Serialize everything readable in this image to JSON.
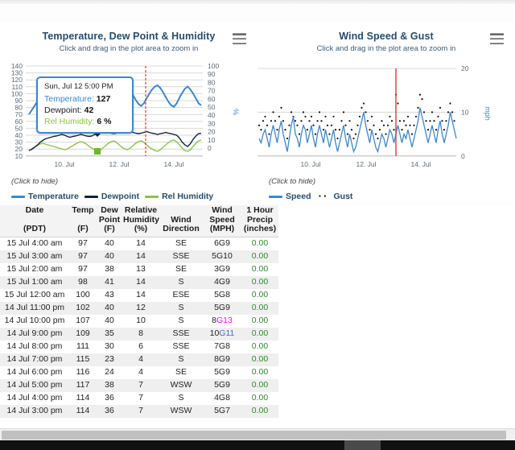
{
  "charts": [
    {
      "id": "temperature",
      "title": "Temperature, Dew Point & Humidity",
      "subtitle": "Click and drag in the plot area to zoom in",
      "menu_icon": "hamburger-menu-icon",
      "legend_hint": "(Click to hide)",
      "right_axis_unit": "%",
      "legend": [
        {
          "label": "Temperature",
          "color": "#3a87d4",
          "marker": "line"
        },
        {
          "label": "Dewpoint",
          "color": "#10233f",
          "marker": "line"
        },
        {
          "label": "Rel Humidity",
          "color": "#8bc53f",
          "marker": "line"
        }
      ],
      "tooltip": {
        "header": "Sun, Jul 12 5:00 PM",
        "rows": [
          {
            "label": "Temperature:",
            "value": "127",
            "color": "#3a87d4"
          },
          {
            "label": "Dewpoint:",
            "value": "42",
            "color": "#10233f"
          },
          {
            "label": "Rel Humidity:",
            "value": "6 %",
            "color": "#8bc53f"
          }
        ]
      }
    },
    {
      "id": "wind",
      "title": "Wind Speed & Gust",
      "subtitle": "Click and drag in the plot area to zoom in",
      "menu_icon": "hamburger-menu-icon",
      "legend_hint": "(Click to hide)",
      "right_axis_unit": "mph",
      "legend": [
        {
          "label": "Speed",
          "color": "#3a87d4",
          "marker": "line"
        },
        {
          "label": "Gust",
          "color": "#000000",
          "marker": "dots"
        }
      ]
    }
  ],
  "chart_data": [
    {
      "type": "line",
      "id": "temperature",
      "title": "Temperature, Dew Point & Humidity",
      "subtitle": "Click and drag in the plot area to zoom in",
      "xlabel": "",
      "ylabel": "",
      "right_ylabel": "%",
      "grid": true,
      "legend_position": "bottom-left",
      "x_ticks": [
        "10. Jul",
        "12. Jul",
        "14. Jul"
      ],
      "left_y_ticks": [
        10,
        20,
        30,
        40,
        50,
        60,
        70,
        80,
        90,
        100,
        110,
        120,
        130,
        140
      ],
      "left_ylim": [
        10,
        140
      ],
      "right_y_ticks": [
        0,
        10,
        20,
        30,
        40,
        50,
        60,
        70,
        80,
        90,
        100
      ],
      "right_ylim": [
        0,
        100
      ],
      "plotline": {
        "color": "#e8362b",
        "style": "dashed",
        "x_label": "13. Jul"
      },
      "series": [
        {
          "name": "Temperature",
          "color": "#3a87d4",
          "axis": "left",
          "values": [
            84,
            90,
            96,
            102,
            108,
            112,
            110,
            106,
            101,
            97,
            100,
            107,
            114,
            120,
            122,
            118,
            112,
            105,
            99,
            95,
            99,
            106,
            113,
            119,
            123,
            127,
            124,
            118,
            111,
            104,
            98,
            95,
            99,
            106,
            113,
            118,
            121,
            118,
            112,
            105,
            99,
            96,
            100,
            107,
            114,
            120,
            124,
            126,
            122,
            116,
            109,
            102,
            97,
            95,
            100,
            108,
            115,
            121,
            124,
            120,
            114,
            107,
            100,
            97
          ]
        },
        {
          "name": "Dewpoint",
          "color": "#10233f",
          "axis": "left",
          "values": [
            18,
            20,
            23,
            26,
            30,
            33,
            35,
            36,
            37,
            38,
            39,
            40,
            41,
            40,
            38,
            37,
            38,
            39,
            40,
            41,
            40,
            39,
            38,
            39,
            41,
            42,
            43,
            44,
            45,
            44,
            43,
            42,
            43,
            44,
            46,
            47,
            46,
            45,
            44,
            43,
            42,
            43,
            44,
            45,
            44,
            43,
            42,
            41,
            42,
            43,
            44,
            43,
            42,
            41,
            40,
            36,
            30,
            26,
            24,
            28,
            34,
            38,
            41,
            42
          ]
        },
        {
          "name": "Rel Humidity",
          "color": "#8bc53f",
          "axis": "right",
          "values": [
            8,
            10,
            12,
            14,
            16,
            17,
            16,
            15,
            14,
            13,
            12,
            11,
            10,
            9,
            10,
            12,
            14,
            16,
            18,
            19,
            18,
            16,
            13,
            11,
            9,
            6,
            8,
            11,
            14,
            17,
            19,
            20,
            18,
            15,
            12,
            10,
            9,
            11,
            14,
            17,
            19,
            20,
            18,
            15,
            12,
            10,
            8,
            7,
            9,
            12,
            15,
            18,
            20,
            21,
            19,
            15,
            11,
            8,
            7,
            9,
            13,
            17,
            20,
            21
          ]
        }
      ],
      "highlight_points": [
        {
          "series": "Temperature",
          "value": 127,
          "label": "Sun, Jul 12 5:00 PM"
        },
        {
          "series": "Dewpoint",
          "value": 42
        },
        {
          "series": "Rel Humidity",
          "value": 6
        }
      ]
    },
    {
      "type": "line",
      "id": "wind",
      "title": "Wind Speed & Gust",
      "subtitle": "Click and drag in the plot area to zoom in",
      "xlabel": "",
      "ylabel": "mph",
      "grid": true,
      "legend_position": "bottom-left",
      "x_ticks": [
        "10. Jul",
        "12. Jul",
        "14. Jul"
      ],
      "y_ticks": [
        0,
        10,
        20
      ],
      "ylim": [
        0,
        20
      ],
      "plotline": {
        "color": "#e8362b",
        "style": "solid",
        "x_label": "13. Jul"
      },
      "series": [
        {
          "name": "Speed",
          "color": "#3a87d4",
          "style": "line",
          "values": [
            4,
            3,
            5,
            6,
            4,
            2,
            5,
            7,
            5,
            3,
            6,
            8,
            5,
            3,
            1,
            4,
            7,
            9,
            6,
            4,
            2,
            5,
            8,
            6,
            3,
            5,
            7,
            4,
            2,
            5,
            8,
            5,
            3,
            6,
            4,
            2,
            4,
            6,
            3,
            1,
            3,
            5,
            7,
            4,
            2,
            5,
            3,
            1,
            2,
            4,
            6,
            8,
            10,
            7,
            5,
            3,
            6,
            4,
            2,
            1,
            3,
            5,
            4,
            2,
            4,
            6,
            5,
            3,
            5,
            7,
            5,
            3,
            5,
            4,
            6,
            4,
            2,
            4,
            6,
            8,
            11,
            9,
            7,
            5,
            3,
            5,
            7,
            5,
            3,
            6,
            8,
            5,
            3,
            5,
            7,
            10,
            8,
            6,
            4,
            6
          ]
        },
        {
          "name": "Gust",
          "color": "#000000",
          "style": "dots",
          "values": [
            7,
            6,
            8,
            9,
            7,
            5,
            8,
            10,
            8,
            6,
            9,
            11,
            8,
            6,
            4,
            7,
            10,
            9,
            8,
            7,
            5,
            8,
            10,
            9,
            6,
            8,
            9,
            7,
            5,
            8,
            10,
            8,
            6,
            9,
            7,
            5,
            7,
            9,
            6,
            4,
            6,
            8,
            10,
            7,
            5,
            8,
            6,
            4,
            5,
            7,
            9,
            11,
            12,
            10,
            8,
            6,
            9,
            7,
            5,
            4,
            6,
            8,
            7,
            5,
            7,
            9,
            8,
            6,
            14,
            12,
            8,
            6,
            8,
            7,
            9,
            7,
            5,
            7,
            9,
            11,
            14,
            13,
            10,
            8,
            6,
            8,
            10,
            8,
            6,
            9,
            11,
            8,
            6,
            8,
            10,
            13,
            11,
            9,
            7,
            9
          ]
        }
      ]
    }
  ],
  "table": {
    "headers": [
      {
        "line1": "Date",
        "line2": "",
        "line3": "(PDT)"
      },
      {
        "line1": "Temp",
        "line2": "",
        "line3": "(F)"
      },
      {
        "line1": "Dew",
        "line2": "Point",
        "line3": "(F)"
      },
      {
        "line1": "Relative",
        "line2": "Humidity",
        "line3": "(%)"
      },
      {
        "line1": "",
        "line2": "Wind",
        "line3": "Direction"
      },
      {
        "line1": "Wind",
        "line2": "Speed",
        "line3": "(MPH)"
      },
      {
        "line1": "1 Hour",
        "line2": "Precip",
        "line3": "(inches)"
      }
    ],
    "rows": [
      {
        "date": "15 Jul 4:00 am",
        "temp": "97",
        "dew": "40",
        "rh": "14",
        "dir": "SE",
        "spd": "6G9",
        "spd_hi": "",
        "spd_hi_color": "",
        "precip": "0.00"
      },
      {
        "date": "15 Jul 3:00 am",
        "temp": "97",
        "dew": "40",
        "rh": "14",
        "dir": "SSE",
        "spd": "5G10",
        "spd_hi": "",
        "spd_hi_color": "",
        "precip": "0.00"
      },
      {
        "date": "15 Jul 2:00 am",
        "temp": "97",
        "dew": "38",
        "rh": "13",
        "dir": "SE",
        "spd": "3G9",
        "spd_hi": "",
        "spd_hi_color": "",
        "precip": "0.00"
      },
      {
        "date": "15 Jul 1:00 am",
        "temp": "98",
        "dew": "41",
        "rh": "14",
        "dir": "S",
        "spd": "4G9",
        "spd_hi": "",
        "spd_hi_color": "",
        "precip": "0.00"
      },
      {
        "date": "15 Jul 12:00 am",
        "temp": "100",
        "dew": "43",
        "rh": "14",
        "dir": "ESE",
        "spd": "5G8",
        "spd_hi": "",
        "spd_hi_color": "",
        "precip": "0.00"
      },
      {
        "date": "14 Jul 11:00 pm",
        "temp": "102",
        "dew": "40",
        "rh": "12",
        "dir": "S",
        "spd": "5G9",
        "spd_hi": "",
        "spd_hi_color": "",
        "precip": "0.00"
      },
      {
        "date": "14 Jul 10:00 pm",
        "temp": "107",
        "dew": "40",
        "rh": "10",
        "dir": "S",
        "spd": "8",
        "spd_hi": "G13",
        "spd_hi_color": "#ff00ff",
        "precip": "0.00"
      },
      {
        "date": "14 Jul 9:00 pm",
        "temp": "109",
        "dew": "35",
        "rh": "8",
        "dir": "SSE",
        "spd": "10",
        "spd_hi": "G11",
        "spd_hi_color": "#5b5bd6",
        "precip": "0.00"
      },
      {
        "date": "14 Jul 8:00 pm",
        "temp": "111",
        "dew": "30",
        "rh": "6",
        "dir": "SSE",
        "spd": "7G8",
        "spd_hi": "",
        "spd_hi_color": "",
        "precip": "0.00"
      },
      {
        "date": "14 Jul 7:00 pm",
        "temp": "115",
        "dew": "23",
        "rh": "4",
        "dir": "S",
        "spd": "8G9",
        "spd_hi": "",
        "spd_hi_color": "",
        "precip": "0.00"
      },
      {
        "date": "14 Jul 6:00 pm",
        "temp": "116",
        "dew": "24",
        "rh": "4",
        "dir": "SE",
        "spd": "5G9",
        "spd_hi": "",
        "spd_hi_color": "",
        "precip": "0.00"
      },
      {
        "date": "14 Jul 5:00 pm",
        "temp": "117",
        "dew": "38",
        "rh": "7",
        "dir": "WSW",
        "spd": "5G9",
        "spd_hi": "",
        "spd_hi_color": "",
        "precip": "0.00"
      },
      {
        "date": "14 Jul 4:00 pm",
        "temp": "114",
        "dew": "36",
        "rh": "7",
        "dir": "S",
        "spd": "4G8",
        "spd_hi": "",
        "spd_hi_color": "",
        "precip": "0.00"
      },
      {
        "date": "14 Jul 3:00 pm",
        "temp": "114",
        "dew": "36",
        "rh": "7",
        "dir": "WSW",
        "spd": "5G7",
        "spd_hi": "",
        "spd_hi_color": "",
        "precip": "0.00"
      }
    ]
  },
  "colors": {
    "temperature": "#3a87d4",
    "dewpoint": "#10233f",
    "humidity": "#8bc53f",
    "plotline": "#e8362b",
    "title": "#274b6d",
    "precip": "#2c8a2c"
  }
}
